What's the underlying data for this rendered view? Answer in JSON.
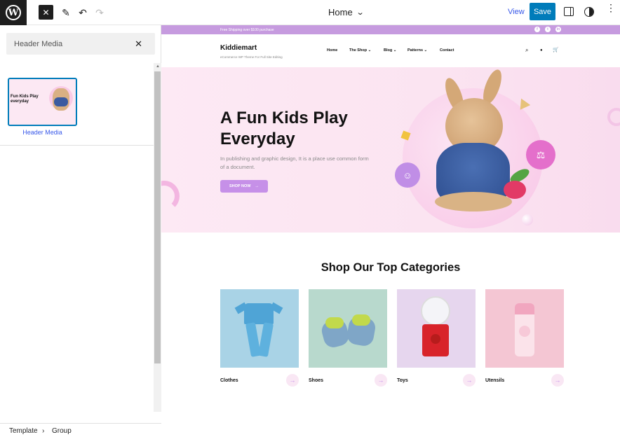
{
  "topbar": {
    "wp_logo": "W",
    "close_icon": "✕",
    "pen_icon": "✎",
    "undo_icon": "↶",
    "redo_icon": "↷",
    "document_title": "Home",
    "title_chevron": "⌄",
    "view_label": "View",
    "save_label": "Save",
    "more_icon": "⋮"
  },
  "sidebar": {
    "search_value": "Header Media",
    "clear_icon": "✕",
    "pattern_label": "Header Media",
    "thumb_text": "Fun Kids Play everyday",
    "breadcrumb": [
      "Template",
      "›",
      "Group"
    ]
  },
  "site": {
    "promo_text": "Free Shipping over $100 purchase",
    "social": [
      "f",
      "t",
      "in"
    ],
    "brand": "Kiddiemart",
    "tagline": "eCommerce WP Theme For Full Site Editing",
    "nav": [
      "Home",
      "The Shop",
      "Blog",
      "Patterns",
      "Contact"
    ],
    "nav_dropdown_caret": "⌄",
    "header_icons": {
      "search": "⌕",
      "account": "●",
      "cart": "🛒"
    },
    "hero": {
      "title": "A Fun Kids Play Everyday",
      "subtitle": "In publishing and graphic design, It is a place use common form of a document.",
      "button_label": "SHOP NOW",
      "button_arrow": "→"
    },
    "categories_title": "Shop Our Top Categories",
    "categories": [
      {
        "name": "Clothes",
        "color": "#a9d3e6",
        "arrow": "→"
      },
      {
        "name": "Shoes",
        "color": "#b8d9cd",
        "arrow": "→"
      },
      {
        "name": "Toys",
        "color": "#e6d6ee",
        "arrow": "→"
      },
      {
        "name": "Utensils",
        "color": "#f4c6d3",
        "arrow": "→"
      }
    ]
  },
  "colors": {
    "accent": "#007cba",
    "brand_purple": "#c690e8",
    "hero_bg": "#fbe4f1"
  }
}
